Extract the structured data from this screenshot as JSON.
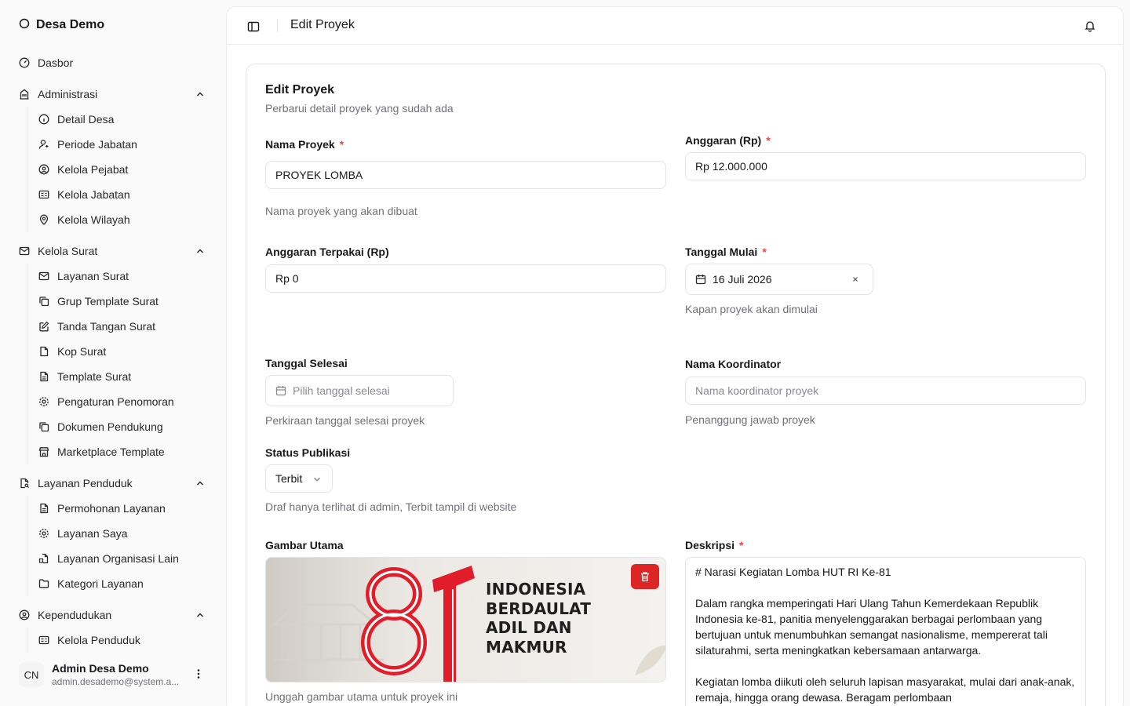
{
  "sidebar": {
    "brand": "Desa Demo",
    "dashboard": "Dasbor",
    "groups": [
      {
        "label": "Administrasi",
        "items": [
          "Detail Desa",
          "Periode Jabatan",
          "Kelola Pejabat",
          "Kelola Jabatan",
          "Kelola Wilayah"
        ]
      },
      {
        "label": "Kelola Surat",
        "items": [
          "Layanan Surat",
          "Grup Template Surat",
          "Tanda Tangan Surat",
          "Kop Surat",
          "Template Surat",
          "Pengaturan Penomoran",
          "Dokumen Pendukung",
          "Marketplace Template"
        ]
      },
      {
        "label": "Layanan Penduduk",
        "items": [
          "Permohonan Layanan",
          "Layanan Saya",
          "Layanan Organisasi Lain",
          "Kategori Layanan"
        ]
      },
      {
        "label": "Kependudukan",
        "items": [
          "Kelola Penduduk"
        ]
      }
    ],
    "user": {
      "initials": "CN",
      "name": "Admin Desa Demo",
      "email": "admin.desademo@system.a..."
    }
  },
  "header": {
    "title": "Edit Proyek"
  },
  "form": {
    "title": "Edit Proyek",
    "subtitle": "Perbarui detail proyek yang sudah ada",
    "required_mark": "*",
    "nama_proyek": {
      "label": "Nama Proyek",
      "value": "PROYEK LOMBA",
      "help": "Nama proyek yang akan dibuat"
    },
    "anggaran": {
      "label": "Anggaran (Rp)",
      "value": "Rp 12.000.000"
    },
    "anggaran_terpakai": {
      "label": "Anggaran Terpakai (Rp)",
      "value": "Rp 0"
    },
    "tanggal_mulai": {
      "label": "Tanggal Mulai",
      "value": "16 Juli 2026",
      "help": "Kapan proyek akan dimulai"
    },
    "tanggal_selesai": {
      "label": "Tanggal Selesai",
      "placeholder": "Pilih tanggal selesai",
      "help": "Perkiraan tanggal selesai proyek"
    },
    "nama_koordinator": {
      "label": "Nama Koordinator",
      "placeholder": "Nama koordinator proyek",
      "help": "Penanggung jawab proyek"
    },
    "status_publikasi": {
      "label": "Status Publikasi",
      "value": "Terbit",
      "help": "Draf hanya terlihat di admin, Terbit tampil di website"
    },
    "gambar_utama": {
      "label": "Gambar Utama",
      "help": "Unggah gambar utama untuk proyek ini",
      "image_text": [
        "INDONESIA",
        "BERDAULAT",
        "ADIL DAN",
        "MAKMUR"
      ]
    },
    "deskripsi": {
      "label": "Deskripsi",
      "paragraphs": [
        "# Narasi Kegiatan Lomba HUT RI Ke-81",
        "Dalam rangka memperingati Hari Ulang Tahun Kemerdekaan Republik Indonesia ke-81, panitia menyelenggarakan berbagai perlombaan yang bertujuan untuk menumbuhkan semangat nasionalisme, mempererat tali silaturahmi, serta meningkatkan kebersamaan antarwarga.",
        "Kegiatan lomba diikuti oleh seluruh lapisan masyarakat, mulai dari anak-anak, remaja, hingga orang dewasa. Beragam perlombaan"
      ]
    }
  },
  "colors": {
    "accent_red": "#dc2626",
    "required": "#ef4444",
    "muted_text": "#71717a",
    "border": "#e4e4e7"
  }
}
